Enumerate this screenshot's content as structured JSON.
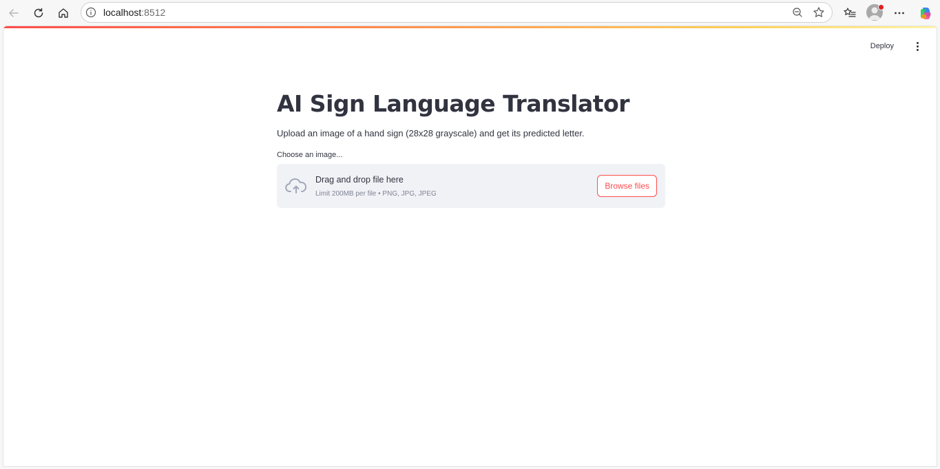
{
  "browser": {
    "url_host": "localhost",
    "url_port": ":8512",
    "icons": [
      "back-icon",
      "reload-icon",
      "home-icon",
      "site-info-icon",
      "zoom-out-icon",
      "favorite-star-icon",
      "favorites-list-icon",
      "profile-avatar",
      "more-icon",
      "copilot-icon"
    ]
  },
  "app": {
    "toolbar": {
      "deploy_label": "Deploy"
    },
    "title": "AI Sign Language Translator",
    "description": "Upload an image of a hand sign (28x28 grayscale) and get its predicted letter.",
    "uploader": {
      "label": "Choose an image...",
      "drop_title": "Drag and drop file here",
      "limit_text": "Limit 200MB per file • PNG, JPG, JPEG",
      "browse_label": "Browse files"
    },
    "colors": {
      "accent": "#ff4b4b",
      "text": "#31333f",
      "dropzone_bg": "#f0f2f6",
      "muted": "#808495"
    }
  }
}
